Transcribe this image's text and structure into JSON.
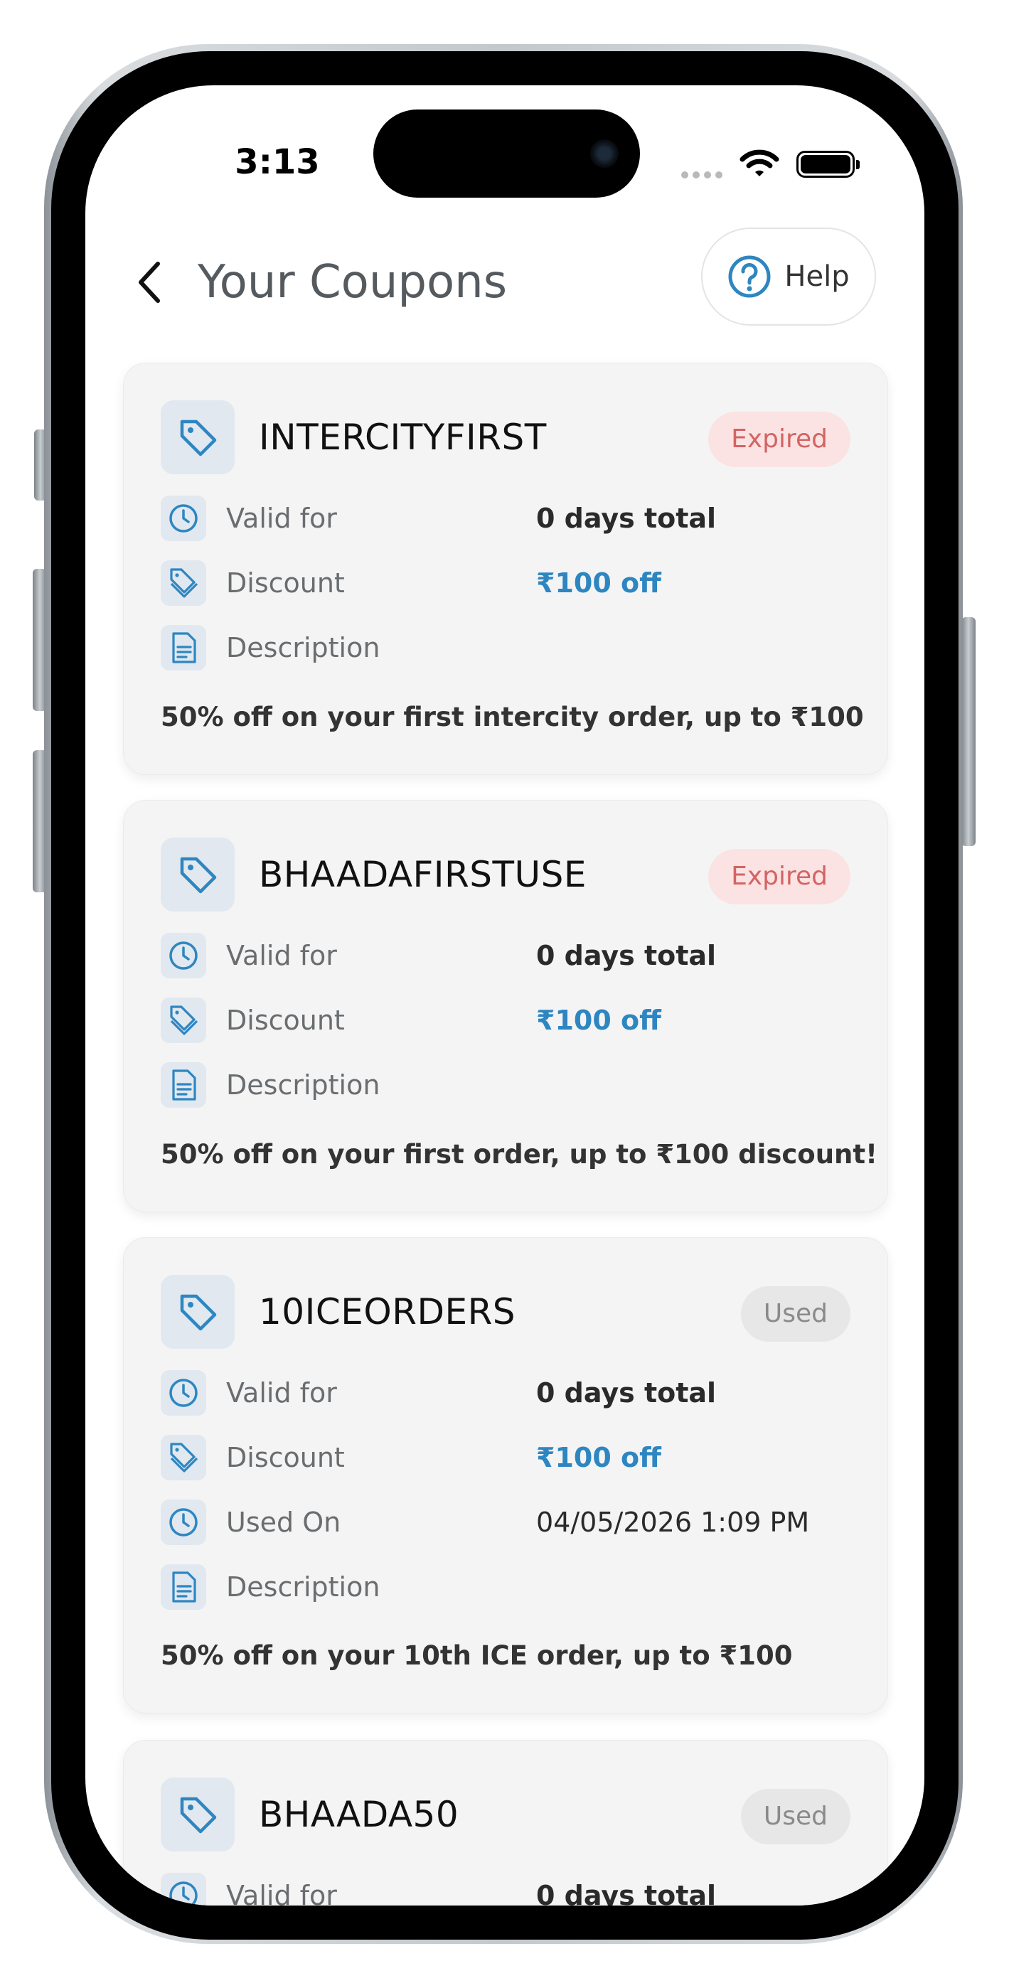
{
  "status_bar": {
    "time": "3:13"
  },
  "header": {
    "title": "Your Coupons",
    "help_label": "Help"
  },
  "labels": {
    "valid_for": "Valid for",
    "discount": "Discount",
    "used_on": "Used On",
    "description": "Description"
  },
  "coupons": [
    {
      "code": "INTERCITYFIRST",
      "status": "Expired",
      "valid_for": "0 days total",
      "discount": "₹100 off",
      "description": "50% off on your first intercity order, up to ₹100"
    },
    {
      "code": "BHAADAFIRSTUSE",
      "status": "Expired",
      "valid_for": "0 days total",
      "discount": "₹100 off",
      "description": "50% off on your first order, up to ₹100 discount!"
    },
    {
      "code": "10ICEORDERS",
      "status": "Used",
      "valid_for": "0 days total",
      "discount": "₹100 off",
      "used_on": "04/05/2026 1:09 PM",
      "description": "50% off on your 10th ICE order, up to ₹100"
    },
    {
      "code": "BHAADA50",
      "status": "Used",
      "valid_for": "0 days total"
    }
  ],
  "colors": {
    "accent": "#2e86c1",
    "expired_bg": "#fbe3e3",
    "expired_text": "#d46464",
    "used_bg": "#e7e7e7",
    "used_text": "#8a8a8a",
    "card_bg": "#f4f4f4"
  },
  "icons": {
    "back": "chevron-left-icon",
    "help": "question-circle-icon",
    "coupon": "tag-icon",
    "valid_for": "clock-icon",
    "discount": "tags-icon",
    "used_on": "clock-icon",
    "description": "document-icon"
  }
}
